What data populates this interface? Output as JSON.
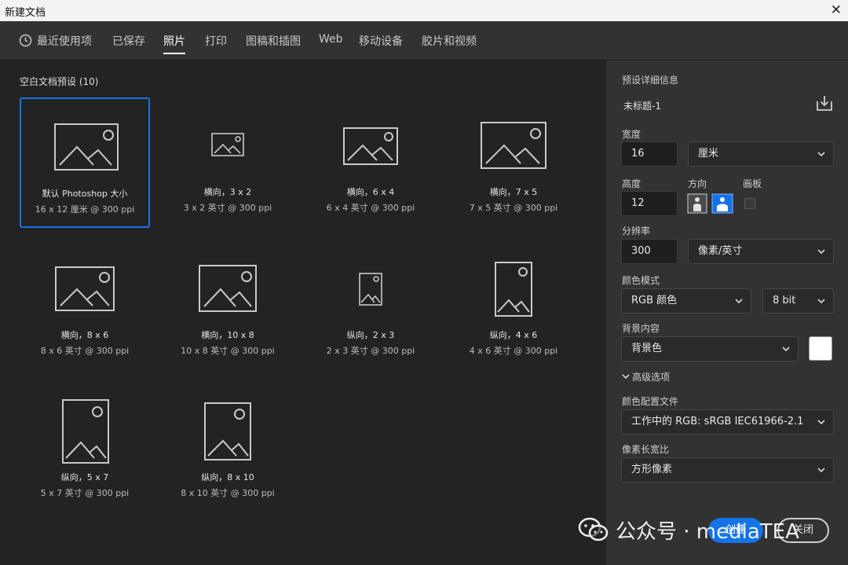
{
  "window": {
    "title": "新建文档",
    "close_glyph": "✕"
  },
  "tabs": [
    {
      "label": "最近使用项",
      "icon": "clock-icon"
    },
    {
      "label": "已保存"
    },
    {
      "label": "照片",
      "active": true
    },
    {
      "label": "打印"
    },
    {
      "label": "图稿和插图"
    },
    {
      "label": "Web"
    },
    {
      "label": "移动设备"
    },
    {
      "label": "胶片和视频"
    }
  ],
  "presets": {
    "title": "空白文档预设 (10)",
    "items": [
      {
        "name": "默认 Photoshop 大小",
        "desc": "16 x 12 厘米 @ 300 ppi",
        "orientation": "landscape",
        "selected": true
      },
      {
        "name": "横向，3 x 2",
        "desc": "3 x 2 英寸 @ 300 ppi",
        "orientation": "landscape-small"
      },
      {
        "name": "横向，6 x 4",
        "desc": "6 x 4 英寸 @ 300 ppi",
        "orientation": "landscape"
      },
      {
        "name": "横向，7 x 5",
        "desc": "7 x 5 英寸 @ 300 ppi",
        "orientation": "landscape"
      },
      {
        "name": "横向，8 x 6",
        "desc": "8 x 6 英寸 @ 300 ppi",
        "orientation": "landscape"
      },
      {
        "name": "横向，10 x 8",
        "desc": "10 x 8 英寸 @ 300 ppi",
        "orientation": "landscape"
      },
      {
        "name": "纵向，2 x 3",
        "desc": "2 x 3 英寸 @ 300 ppi",
        "orientation": "portrait-small"
      },
      {
        "name": "纵向，4 x 6",
        "desc": "4 x 6 英寸 @ 300 ppi",
        "orientation": "portrait"
      },
      {
        "name": "纵向，5 x 7",
        "desc": "5 x 7 英寸 @ 300 ppi",
        "orientation": "portrait"
      },
      {
        "name": "纵向，8 x 10",
        "desc": "8 x 10 英寸 @ 300 ppi",
        "orientation": "portrait"
      }
    ]
  },
  "details": {
    "section_label": "预设详细信息",
    "doc_name": "未标题-1",
    "width": {
      "label": "宽度",
      "value": "16",
      "unit": "厘米"
    },
    "height": {
      "label": "高度",
      "value": "12"
    },
    "orientation_label": "方向",
    "artboard_label": "画板",
    "resolution": {
      "label": "分辨率",
      "value": "300",
      "unit": "像素/英寸"
    },
    "color_mode": {
      "label": "颜色模式",
      "value": "RGB 颜色",
      "bit": "8 bit"
    },
    "background": {
      "label": "背景内容",
      "value": "背景色",
      "swatch": "#ffffff"
    },
    "advanced": "高级选项",
    "color_profile": {
      "label": "颜色配置文件",
      "value": "工作中的 RGB: sRGB IEC61966-2.1"
    },
    "pixel_aspect": {
      "label": "像素长宽比",
      "value": "方形像素"
    }
  },
  "buttons": {
    "create": "创建",
    "close": "关闭"
  },
  "watermark": {
    "text": "公众号 · mediaTEA"
  },
  "colors": {
    "accent": "#1473e6",
    "panel": "#323232",
    "background": "#232323"
  }
}
